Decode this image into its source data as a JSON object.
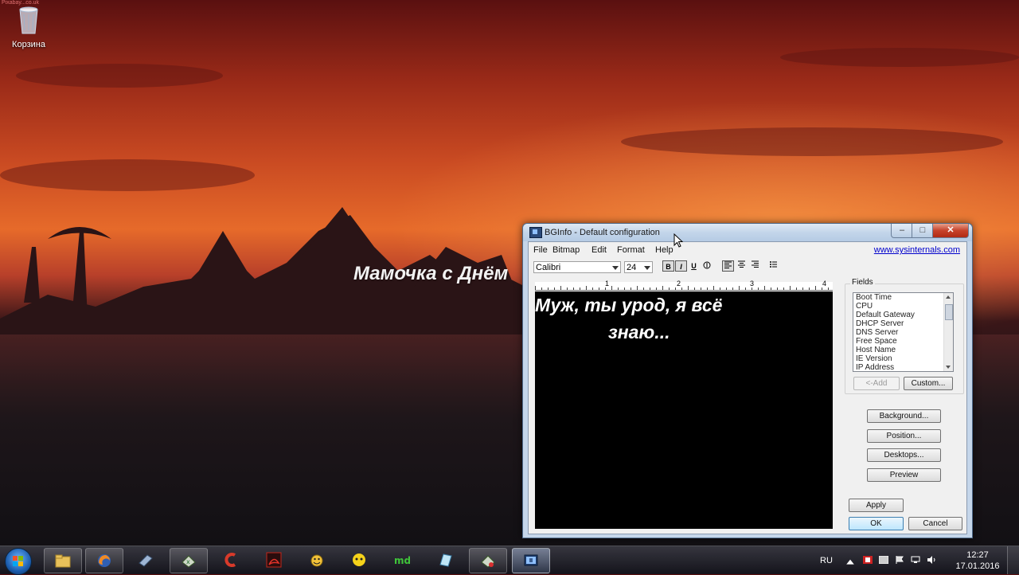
{
  "desktop": {
    "recycle_bin_label": "Корзина",
    "watermark": "Pixabay...co.uk",
    "wallpaper_text": "Мамочка с Днём"
  },
  "window": {
    "title": "BGInfo - Default configuration",
    "menu": [
      "File",
      "Bitmap",
      "Edit",
      "Format",
      "Help"
    ],
    "link": "www.sysinternals.com",
    "font_name": "Calibri",
    "font_size": "24",
    "format_buttons": [
      "B",
      "I",
      "U"
    ],
    "ruler_numbers": [
      "1",
      "2",
      "3",
      "4"
    ],
    "editor_lines": [
      "Муж, ты урод, я всё",
      "знаю..."
    ],
    "fields_label": "Fields",
    "fields": [
      "Boot Time",
      "CPU",
      "Default Gateway",
      "DHCP Server",
      "DNS Server",
      "Free Space",
      "Host Name",
      "IE Version",
      "IP Address"
    ],
    "buttons": {
      "add": "<-Add",
      "custom": "Custom...",
      "background": "Background...",
      "position": "Position...",
      "desktops": "Desktops...",
      "preview": "Preview",
      "apply": "Apply",
      "ok": "OK",
      "cancel": "Cancel"
    }
  },
  "taskbar": {
    "items": [
      "explorer-icon",
      "firefox-icon",
      "scanner-icon",
      "excel-icon",
      "ccleaner-icon",
      "acrobat-icon",
      "emoticon-icon",
      "cyberghost-icon",
      "md-icon",
      "notepad-icon",
      "edit-icon",
      "bginfo-icon"
    ],
    "language": "RU",
    "time": "12:27",
    "date": "17.01.2016"
  },
  "colors": {
    "accent": "#3c7fb1",
    "link": "#0000cc",
    "editor_bg": "#000000"
  }
}
